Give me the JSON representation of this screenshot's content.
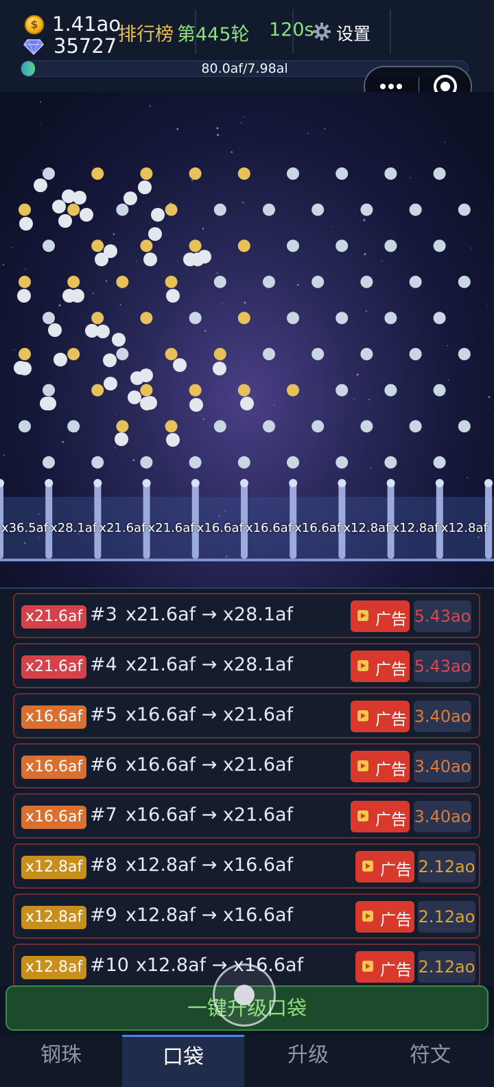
{
  "header": {
    "coins": "1.41ao",
    "gems": "35727",
    "leaderboard_label": "排行榜",
    "round_label": "第445轮",
    "timer": "120s",
    "settings_label": "设置",
    "progress_text": "80.0af/7.98al",
    "progress_fraction": 0.03
  },
  "icons": {
    "coin": "coin-icon",
    "gem": "diamond-icon",
    "settings": "gear-icon",
    "more": "more-dots-icon",
    "target": "target-icon",
    "ad": "video-ad-icon"
  },
  "board": {
    "bucket_labels": [
      "x36.5af",
      "x28.1af",
      "x21.6af",
      "x21.6af",
      "x16.6af",
      "x16.6af",
      "x16.6af",
      "x12.8af",
      "x12.8af",
      "x12.8af"
    ],
    "peg_colors": {
      "gold": "#e8c15a",
      "silver": "#c9d6e3"
    }
  },
  "pockets": [
    {
      "badge": "x21.6af",
      "badge_color": "#d7424a",
      "index": "#3",
      "change": "x21.6af → x28.1af",
      "ad_label": "广告",
      "cost": "5.43ao",
      "cost_color": "#d9474d"
    },
    {
      "badge": "x21.6af",
      "badge_color": "#d7424a",
      "index": "#4",
      "change": "x21.6af → x28.1af",
      "ad_label": "广告",
      "cost": "5.43ao",
      "cost_color": "#d9474d"
    },
    {
      "badge": "x16.6af",
      "badge_color": "#d97030",
      "index": "#5",
      "change": "x16.6af → x21.6af",
      "ad_label": "广告",
      "cost": "3.40ao",
      "cost_color": "#e07a34"
    },
    {
      "badge": "x16.6af",
      "badge_color": "#d97030",
      "index": "#6",
      "change": "x16.6af → x21.6af",
      "ad_label": "广告",
      "cost": "3.40ao",
      "cost_color": "#e07a34"
    },
    {
      "badge": "x16.6af",
      "badge_color": "#d97030",
      "index": "#7",
      "change": "x16.6af → x21.6af",
      "ad_label": "广告",
      "cost": "3.40ao",
      "cost_color": "#e07a34"
    },
    {
      "badge": "x12.8af",
      "badge_color": "#c98f1c",
      "index": "#8",
      "change": "x12.8af → x16.6af",
      "ad_label": "广告",
      "cost": "2.12ao",
      "cost_color": "#e2a424"
    },
    {
      "badge": "x12.8af",
      "badge_color": "#c98f1c",
      "index": "#9",
      "change": "x12.8af → x16.6af",
      "ad_label": "广告",
      "cost": "2.12ao",
      "cost_color": "#e2a424"
    },
    {
      "badge": "x12.8af",
      "badge_color": "#c98f1c",
      "index": "#10",
      "change": "x12.8af → x16.6af",
      "ad_label": "广告",
      "cost": "2.12ao",
      "cost_color": "#e2a424"
    }
  ],
  "upgrade_all_label": "一键升级口袋",
  "tabs": [
    {
      "label": "钢珠",
      "active": false
    },
    {
      "label": "口袋",
      "active": true
    },
    {
      "label": "升级",
      "active": false
    },
    {
      "label": "符文",
      "active": false
    }
  ]
}
